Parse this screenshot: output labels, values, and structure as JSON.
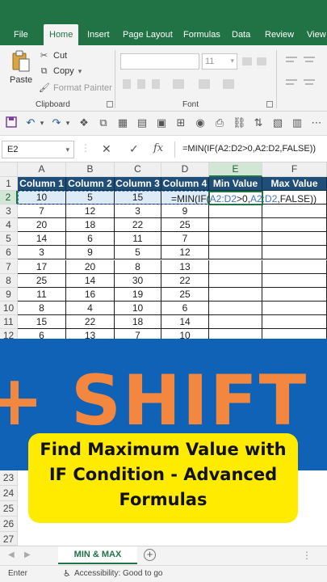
{
  "ribbon_tabs": [
    "File",
    "Home",
    "Insert",
    "Page Layout",
    "Formulas",
    "Data",
    "Review",
    "View"
  ],
  "active_tab": "Home",
  "clipboard": {
    "paste": "Paste",
    "cut": "Cut",
    "copy": "Copy",
    "format_painter": "Format Painter",
    "group_label": "Clipboard"
  },
  "font_group": {
    "size": "11",
    "group_label": "Font"
  },
  "name_box": "E2",
  "formula_bar": {
    "cancel": "✕",
    "enter": "✓",
    "fx": "fx",
    "formula": "=MIN(IF(A2:D2>0,A2:D2,FALSE))"
  },
  "columns": [
    "A",
    "B",
    "C",
    "D",
    "E",
    "F"
  ],
  "header_row": [
    "Column 1",
    "Column 2",
    "Column 3",
    "Column 4",
    "Min Value",
    "Max Value"
  ],
  "rows": [
    {
      "n": "2",
      "v": [
        "10",
        "5",
        "15",
        ""
      ]
    },
    {
      "n": "3",
      "v": [
        "7",
        "12",
        "3",
        "9"
      ]
    },
    {
      "n": "4",
      "v": [
        "20",
        "18",
        "22",
        "25"
      ]
    },
    {
      "n": "5",
      "v": [
        "14",
        "6",
        "11",
        "7"
      ]
    },
    {
      "n": "6",
      "v": [
        "3",
        "9",
        "5",
        "12"
      ]
    },
    {
      "n": "7",
      "v": [
        "17",
        "20",
        "8",
        "13"
      ]
    },
    {
      "n": "8",
      "v": [
        "25",
        "14",
        "30",
        "22"
      ]
    },
    {
      "n": "9",
      "v": [
        "11",
        "16",
        "19",
        "25"
      ]
    },
    {
      "n": "10",
      "v": [
        "8",
        "4",
        "10",
        "6"
      ]
    },
    {
      "n": "11",
      "v": [
        "15",
        "22",
        "18",
        "14"
      ]
    },
    {
      "n": "12",
      "v": [
        "6",
        "13",
        "7",
        "10"
      ]
    }
  ],
  "edit_formula": {
    "p1": "=MIN(IF(",
    "r1": "A2:D2",
    "p2": ">0,",
    "r2": "A2:D2",
    "p3": ",FALSE))"
  },
  "banner_text": "+ SHIFT + E",
  "callout": {
    "line1": "Find Maximum Value with",
    "line2": "IF Condition - Advanced",
    "line3": "Formulas"
  },
  "lower_rows": [
    "23",
    "24",
    "25",
    "26",
    "27"
  ],
  "sheet_tab": "MIN & MAX",
  "add_sheet": "+",
  "status": {
    "mode": "Enter",
    "accessibility": "Accessibility: Good to go"
  },
  "colors": {
    "excel_green": "#217346",
    "header_fill": "#1f4e79",
    "highlight_fill": "#ddebf7",
    "banner_blue": "#0f62b5",
    "banner_orange": "#f4873f",
    "callout_yellow": "#ffeb00"
  }
}
